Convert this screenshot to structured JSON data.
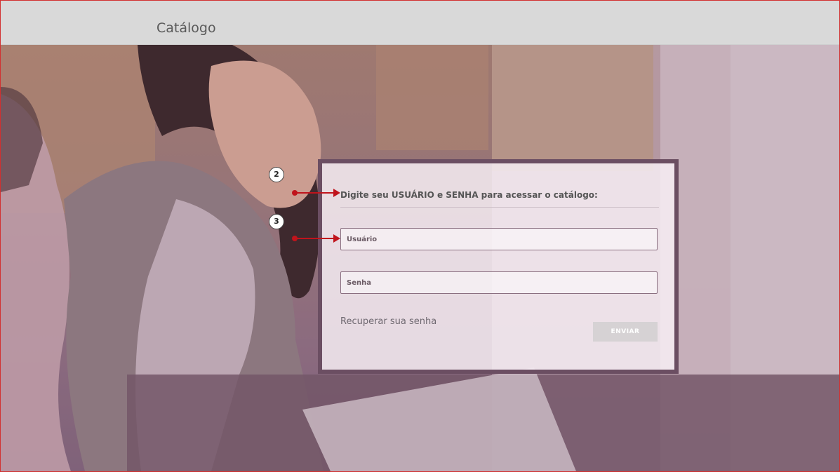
{
  "header": {
    "title": "Catálogo"
  },
  "login": {
    "heading": "Digite seu USUÁRIO e SENHA para acessar o catálogo:",
    "username_placeholder": "Usuário",
    "password_placeholder": "Senha",
    "recover_label": "Recuperar sua senha",
    "submit_label": "ENVIAR"
  },
  "annotations": {
    "step_user": "2",
    "step_pass": "3"
  },
  "colors": {
    "frame_border": "#d23030",
    "header_bg": "#d9d9d9",
    "box_border": "#6b4e62",
    "arrow": "#c0141c",
    "button_bg": "#d6d2d4"
  }
}
